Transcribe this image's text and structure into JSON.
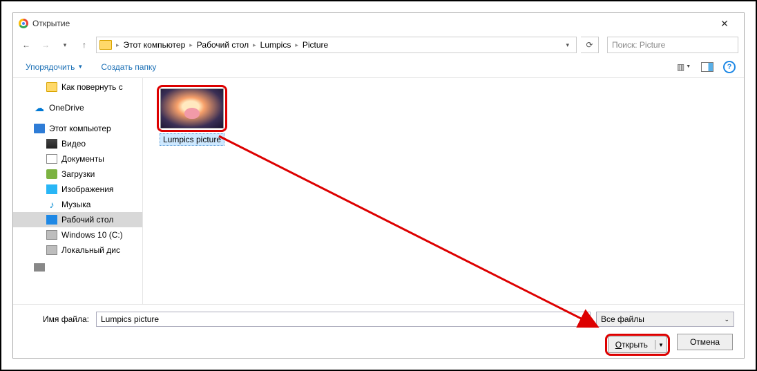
{
  "window": {
    "title": "Открытие"
  },
  "breadcrumb": {
    "items": [
      "Этот компьютер",
      "Рабочий стол",
      "Lumpics",
      "Picture"
    ]
  },
  "search": {
    "placeholder": "Поиск: Picture"
  },
  "toolbar": {
    "organize": "Упорядочить",
    "new_folder": "Создать папку"
  },
  "sidebar": {
    "items": [
      {
        "label": "Как повернуть с",
        "icon": "folder",
        "indent": 2
      },
      {
        "label": "OneDrive",
        "icon": "onedrive",
        "indent": 1
      },
      {
        "label": "Этот компьютер",
        "icon": "pc",
        "indent": 1
      },
      {
        "label": "Видео",
        "icon": "video",
        "indent": 2
      },
      {
        "label": "Документы",
        "icon": "doc",
        "indent": 2
      },
      {
        "label": "Загрузки",
        "icon": "down",
        "indent": 2
      },
      {
        "label": "Изображения",
        "icon": "img",
        "indent": 2
      },
      {
        "label": "Музыка",
        "icon": "music",
        "indent": 2
      },
      {
        "label": "Рабочий стол",
        "icon": "desktop",
        "indent": 2,
        "selected": true
      },
      {
        "label": "Windows 10 (C:)",
        "icon": "drive",
        "indent": 2
      },
      {
        "label": "Локальный дис",
        "icon": "drive",
        "indent": 2
      }
    ]
  },
  "content": {
    "file_name": "Lumpics picture"
  },
  "footer": {
    "filename_label": "Имя файла:",
    "filename_value": "Lumpics picture",
    "filter_label": "Все файлы",
    "open_label": "Открыть",
    "cancel_label": "Отмена"
  }
}
